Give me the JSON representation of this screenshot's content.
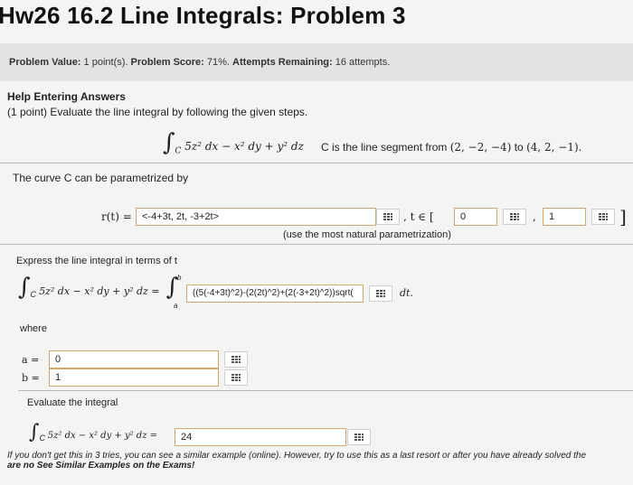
{
  "header": {
    "title": "Hw26 16.2 Line Integrals: Problem 3"
  },
  "info": {
    "value_label": "Problem Value:",
    "value_text": "1 point(s).",
    "score_label": "Problem Score:",
    "score_text": "71%.",
    "attempts_label": "Attempts Remaining:",
    "attempts_text": "16 attempts."
  },
  "help": {
    "title": "Help Entering Answers",
    "prompt": "(1 point) Evaluate the line integral by following the given steps."
  },
  "problem": {
    "integrand": "5z² dx − x² dy + y² dz",
    "integral_sub": "C",
    "segment_prefix": "C is the line segment from",
    "segment_from": "(2, −2, −4)",
    "segment_mid": "to",
    "segment_to": "(4, 2, −1)."
  },
  "curve": {
    "label": "The curve C can be parametrized by",
    "r_label": "r(t) =",
    "r_value": "<-4+3t, 2t, -3+2t>",
    "t_label": ", t ∈ [",
    "t_start": "0",
    "t_comma": ",",
    "t_end": "1",
    "t_close": "]",
    "hint": "(use the most natural parametrization)"
  },
  "express": {
    "label": "Express the line integral in terms of t",
    "integrand": "5z² dx − x² dy + y² dz =",
    "sub": "C",
    "upper": "b",
    "lower": "a",
    "value": "((5(-4+3t)^2)-(2(2t)^2)+(2(-3+2t)^2))sqrt(",
    "dt": "dt."
  },
  "bounds": {
    "where": "where",
    "a_label": "a =",
    "a_value": "0",
    "b_label": "b =",
    "b_value": "1"
  },
  "evaluate": {
    "label": "Evaluate the integral",
    "integrand": "5z² dx − x² dy + y² dz =",
    "sub": "C",
    "value": "24"
  },
  "footnote": {
    "text": "If you don't get this in 3 tries, you can see a similar example (online). However, try to use this as a last resort or after you have already solved the",
    "text2": "are no See Similar Examples on the Exams!"
  }
}
